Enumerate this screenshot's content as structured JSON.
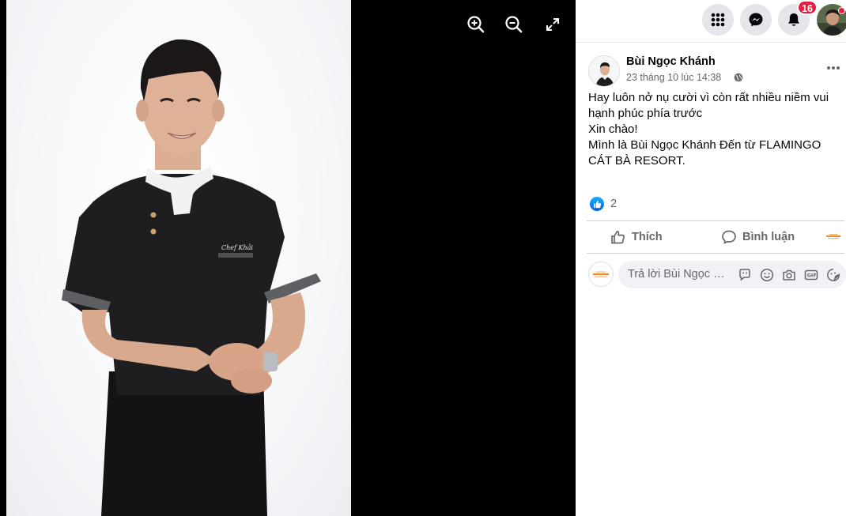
{
  "viewer": {
    "photo_alt": "",
    "chef_badge": "Chef Khải"
  },
  "topbar": {
    "notifications_count": "16"
  },
  "post": {
    "author": "Bùi Ngọc Khánh",
    "time": "23 tháng 10 lúc 14:38",
    "lines": [
      "Hay luôn nở nụ cười vì còn rất nhiều niềm vui",
      "hạnh phúc phía trước",
      "Xin chào!",
      "Mình là Bùi Ngọc Khánh Đến từ FLAMINGO",
      "CÁT BÀ RESORT."
    ],
    "reaction_count": "2"
  },
  "actions": {
    "like_label": "Thích",
    "comment_label": "Bình luận"
  },
  "comment": {
    "placeholder": "Trả lời Bùi Ngọc Khánh..."
  },
  "colors": {
    "accent": "#1877f2",
    "badge": "#e41e3f",
    "secondary_text": "#65676b"
  },
  "icons": [
    "zoom-in-icon",
    "zoom-out-icon",
    "fullscreen-icon",
    "menu-grid-icon",
    "messenger-icon",
    "bell-icon",
    "globe-icon",
    "more-icon",
    "like-icon",
    "comment-icon",
    "sticker-icon",
    "emoji-icon",
    "camera-icon",
    "gif-icon"
  ]
}
